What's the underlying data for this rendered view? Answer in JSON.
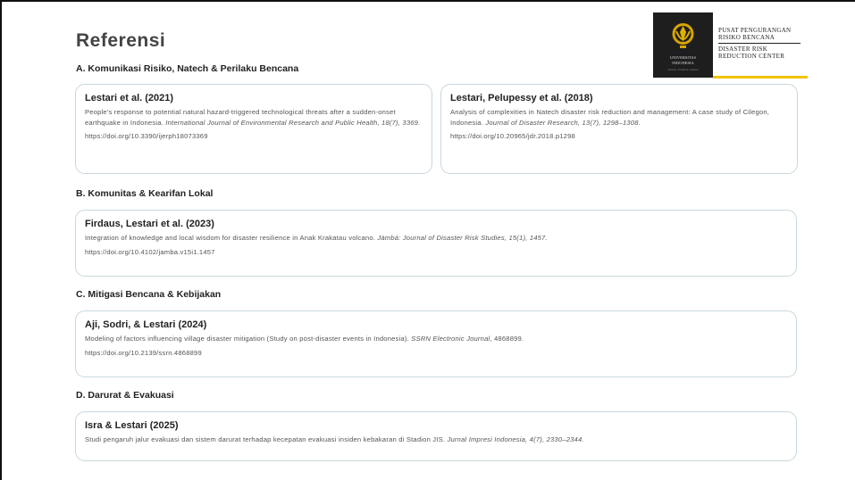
{
  "title": "Referensi",
  "logo": {
    "institution_line1": "UNIVERSITAS",
    "institution_line2": "INDONESIA",
    "motto": "Veritas, Probitas, Iustitia",
    "center_id_line1": "PUSAT PENGURANGAN",
    "center_id_line2": "RISIKO BENCANA",
    "center_en_line1": "DISASTER RISK",
    "center_en_line2": "REDUCTION CENTER"
  },
  "sections": {
    "a": {
      "heading": "A. Komunikasi Risiko, Natech & Perilaku Bencana",
      "refs": [
        {
          "title": "Lestari et al. (2021)",
          "text": "People's response to potential natural hazard-triggered technological threats after a sudden-onset earthquake in Indonesia. ",
          "journal": "International Journal of Environmental Research and Public Health, 18(7), 3369.",
          "doi": "https://doi.org/10.3390/ijerph18073369"
        },
        {
          "title": "Lestari, Pelupessy et al. (2018)",
          "text": "Analysis of complexities in Natech disaster risk reduction and management: A case study of Cilegon, Indonesia. ",
          "journal": "Journal of Disaster Research, 13(7), 1298–1308.",
          "doi": "https://doi.org/10.20965/jdr.2018.p1298"
        }
      ]
    },
    "b": {
      "heading": "B. Komunitas & Kearifan Lokal",
      "refs": [
        {
          "title": "Firdaus, Lestari et al. (2023)",
          "text": "Integration of knowledge and local wisdom for disaster resilience in Anak Krakatau volcano. ",
          "journal": "Jàmbá: Journal of Disaster Risk Studies, 15(1), 1457.",
          "doi": "https://doi.org/10.4102/jamba.v15i1.1457"
        }
      ]
    },
    "c": {
      "heading": "C. Mitigasi Bencana & Kebijakan",
      "refs": [
        {
          "title": "Aji, Sodri, & Lestari (2024)",
          "text": "Modeling of factors influencing village disaster mitigation (Study on post-disaster events in Indonesia). ",
          "journal": "SSRN Electronic Journal",
          "journal_tail": ", 4868899.",
          "doi": "https://doi.org/10.2139/ssrn.4868899"
        }
      ]
    },
    "d": {
      "heading": "D. Darurat & Evakuasi",
      "refs": [
        {
          "title": "Isra & Lestari (2025)",
          "text": "Studi pengaruh jalur evakuasi dan sistem darurat terhadap kecepatan evakuasi insiden kebakaran di Stadion JIS. ",
          "journal": "Jurnal Impresi Indonesia, 4(7), 2330–2344."
        }
      ]
    }
  }
}
